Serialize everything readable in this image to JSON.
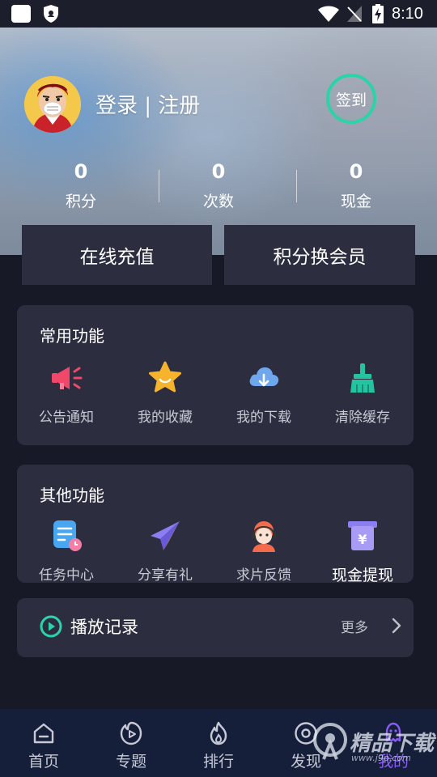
{
  "status_bar": {
    "time": "8:10"
  },
  "profile": {
    "login_register": "登录 | 注册",
    "signin_label": "签到"
  },
  "stats": [
    {
      "value": "0",
      "label": "积分"
    },
    {
      "value": "0",
      "label": "次数"
    },
    {
      "value": "0",
      "label": "现金"
    }
  ],
  "actions": {
    "recharge": "在线充值",
    "exchange": "积分换会员"
  },
  "common_functions": {
    "title": "常用功能",
    "items": [
      {
        "label": "公告通知",
        "icon": "megaphone-icon"
      },
      {
        "label": "我的收藏",
        "icon": "star-icon"
      },
      {
        "label": "我的下载",
        "icon": "cloud-download-icon"
      },
      {
        "label": "清除缓存",
        "icon": "broom-icon"
      }
    ]
  },
  "other_functions": {
    "title": "其他功能",
    "items": [
      {
        "label": "任务中心",
        "icon": "task-icon"
      },
      {
        "label": "分享有礼",
        "icon": "paper-plane-icon"
      },
      {
        "label": "求片反馈",
        "icon": "support-agent-icon"
      },
      {
        "label": "现金提现",
        "icon": "cash-withdraw-icon"
      }
    ]
  },
  "history": {
    "title": "播放记录",
    "more": "更多"
  },
  "bottom_nav": [
    {
      "label": "首页",
      "icon": "home-icon"
    },
    {
      "label": "专题",
      "icon": "topic-icon"
    },
    {
      "label": "排行",
      "icon": "flame-icon"
    },
    {
      "label": "发现",
      "icon": "discover-icon"
    },
    {
      "label": "我的",
      "icon": "profile-icon",
      "active": true
    }
  ],
  "watermark": {
    "title": "精品下载",
    "url": "www.j9p.com"
  },
  "colors": {
    "accent_green": "#2bd4a8",
    "active_tab": "#8a5cf6",
    "card_bg": "#2c2e40",
    "page_bg": "#181927"
  }
}
